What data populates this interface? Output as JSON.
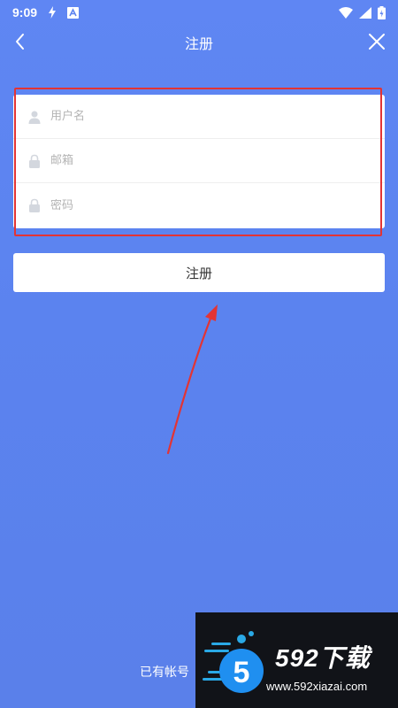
{
  "status_bar": {
    "time": "9:09"
  },
  "appbar": {
    "title": "注册"
  },
  "form": {
    "username": {
      "placeholder": "用户名"
    },
    "email": {
      "placeholder": "邮箱"
    },
    "password": {
      "placeholder": "密码"
    }
  },
  "register_button": {
    "label": "注册"
  },
  "login_link": {
    "label": "已有帐号"
  },
  "watermark": {
    "title": "592下载",
    "url": "www.592xiazai.com",
    "digit": "5"
  },
  "colors": {
    "background": "#5d84f0",
    "annotation": "#e33434",
    "card": "#ffffff"
  }
}
